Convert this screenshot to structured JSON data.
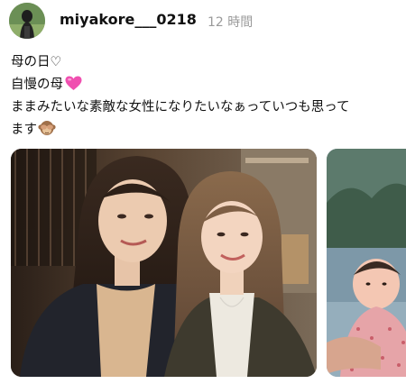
{
  "post": {
    "username": "miyakore___0218",
    "timestamp": "12 時間",
    "caption": {
      "line1": "母の日♡",
      "line2": "自慢の母",
      "line3": "ままみたいな素敵な女性になりたいなぁっていつも思って",
      "line4": "ます"
    },
    "emoji": {
      "line2": "pink-heart",
      "line4": "see-no-evil-monkey"
    },
    "photos": [
      {
        "name": "mother-and-daughter-selfie"
      },
      {
        "name": "baby-photo"
      }
    ]
  },
  "colors": {
    "timestamp": "#9a9a9a",
    "heart": "#f04fb0"
  }
}
